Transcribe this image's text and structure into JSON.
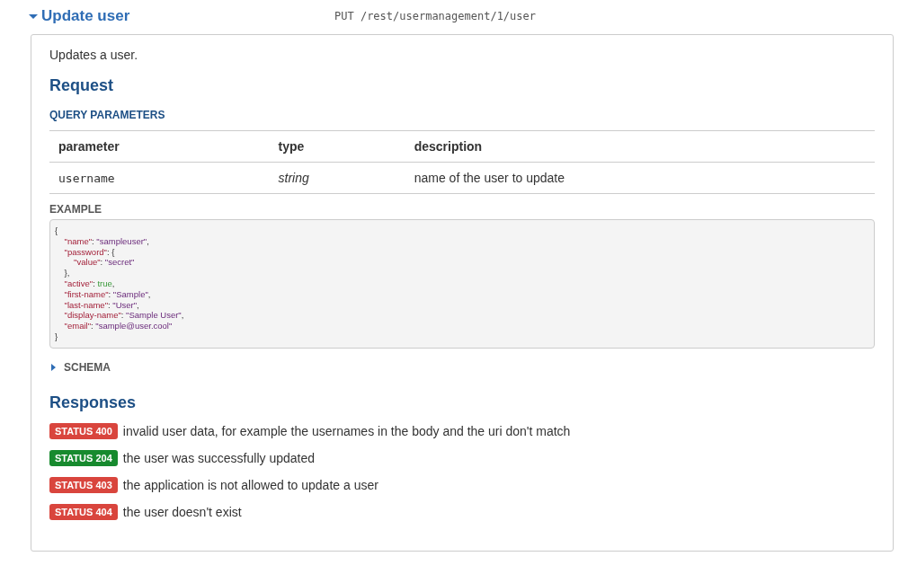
{
  "endpoint": {
    "title": "Update user",
    "expanded": true,
    "method": "PUT",
    "path": "/rest/usermanagement/1/user"
  },
  "description": "Updates a user.",
  "request": {
    "heading": "Request",
    "query_heading": "QUERY PARAMETERS",
    "table": {
      "columns": [
        "parameter",
        "type",
        "description"
      ],
      "rows": [
        {
          "parameter": "username",
          "type": "string",
          "description": "name of the user to update"
        }
      ]
    },
    "example_heading": "EXAMPLE",
    "example_lines": [
      [
        {
          "kind": "punct",
          "text": "{"
        }
      ],
      [
        {
          "kind": "key",
          "text": "    \"name\""
        },
        {
          "kind": "punct",
          "text": ": "
        },
        {
          "kind": "string",
          "text": "\"sampleuser\""
        },
        {
          "kind": "punct",
          "text": ","
        }
      ],
      [
        {
          "kind": "key",
          "text": "    \"password\""
        },
        {
          "kind": "punct",
          "text": ": {"
        }
      ],
      [
        {
          "kind": "key",
          "text": "        \"value\""
        },
        {
          "kind": "punct",
          "text": ": "
        },
        {
          "kind": "string",
          "text": "\"secret\""
        }
      ],
      [
        {
          "kind": "punct",
          "text": "    },"
        }
      ],
      [
        {
          "kind": "key",
          "text": "    \"active\""
        },
        {
          "kind": "punct",
          "text": ": "
        },
        {
          "kind": "bool",
          "text": "true"
        },
        {
          "kind": "punct",
          "text": ","
        }
      ],
      [
        {
          "kind": "key",
          "text": "    \"first-name\""
        },
        {
          "kind": "punct",
          "text": ": "
        },
        {
          "kind": "string",
          "text": "\"Sample\""
        },
        {
          "kind": "punct",
          "text": ","
        }
      ],
      [
        {
          "kind": "key",
          "text": "    \"last-name\""
        },
        {
          "kind": "punct",
          "text": ": "
        },
        {
          "kind": "string",
          "text": "\"User\""
        },
        {
          "kind": "punct",
          "text": ","
        }
      ],
      [
        {
          "kind": "key",
          "text": "    \"display-name\""
        },
        {
          "kind": "punct",
          "text": ": "
        },
        {
          "kind": "string",
          "text": "\"Sample User\""
        },
        {
          "kind": "punct",
          "text": ","
        }
      ],
      [
        {
          "kind": "key",
          "text": "    \"email\""
        },
        {
          "kind": "punct",
          "text": ": "
        },
        {
          "kind": "string",
          "text": "\"sample@user.cool\""
        }
      ],
      [
        {
          "kind": "punct",
          "text": "}"
        }
      ]
    ],
    "schema": {
      "label": "SCHEMA",
      "expanded": false
    }
  },
  "responses": {
    "heading": "Responses",
    "items": [
      {
        "status": "STATUS 400",
        "color": "#d9453d",
        "text": "invalid user data, for example the usernames in the body and the uri don't match"
      },
      {
        "status": "STATUS 204",
        "color": "#178a2e",
        "text": "the user was successfully updated"
      },
      {
        "status": "STATUS 403",
        "color": "#d9453d",
        "text": "the application is not allowed to update a user"
      },
      {
        "status": "STATUS 404",
        "color": "#d9453d",
        "text": "the user doesn't exist"
      }
    ]
  }
}
